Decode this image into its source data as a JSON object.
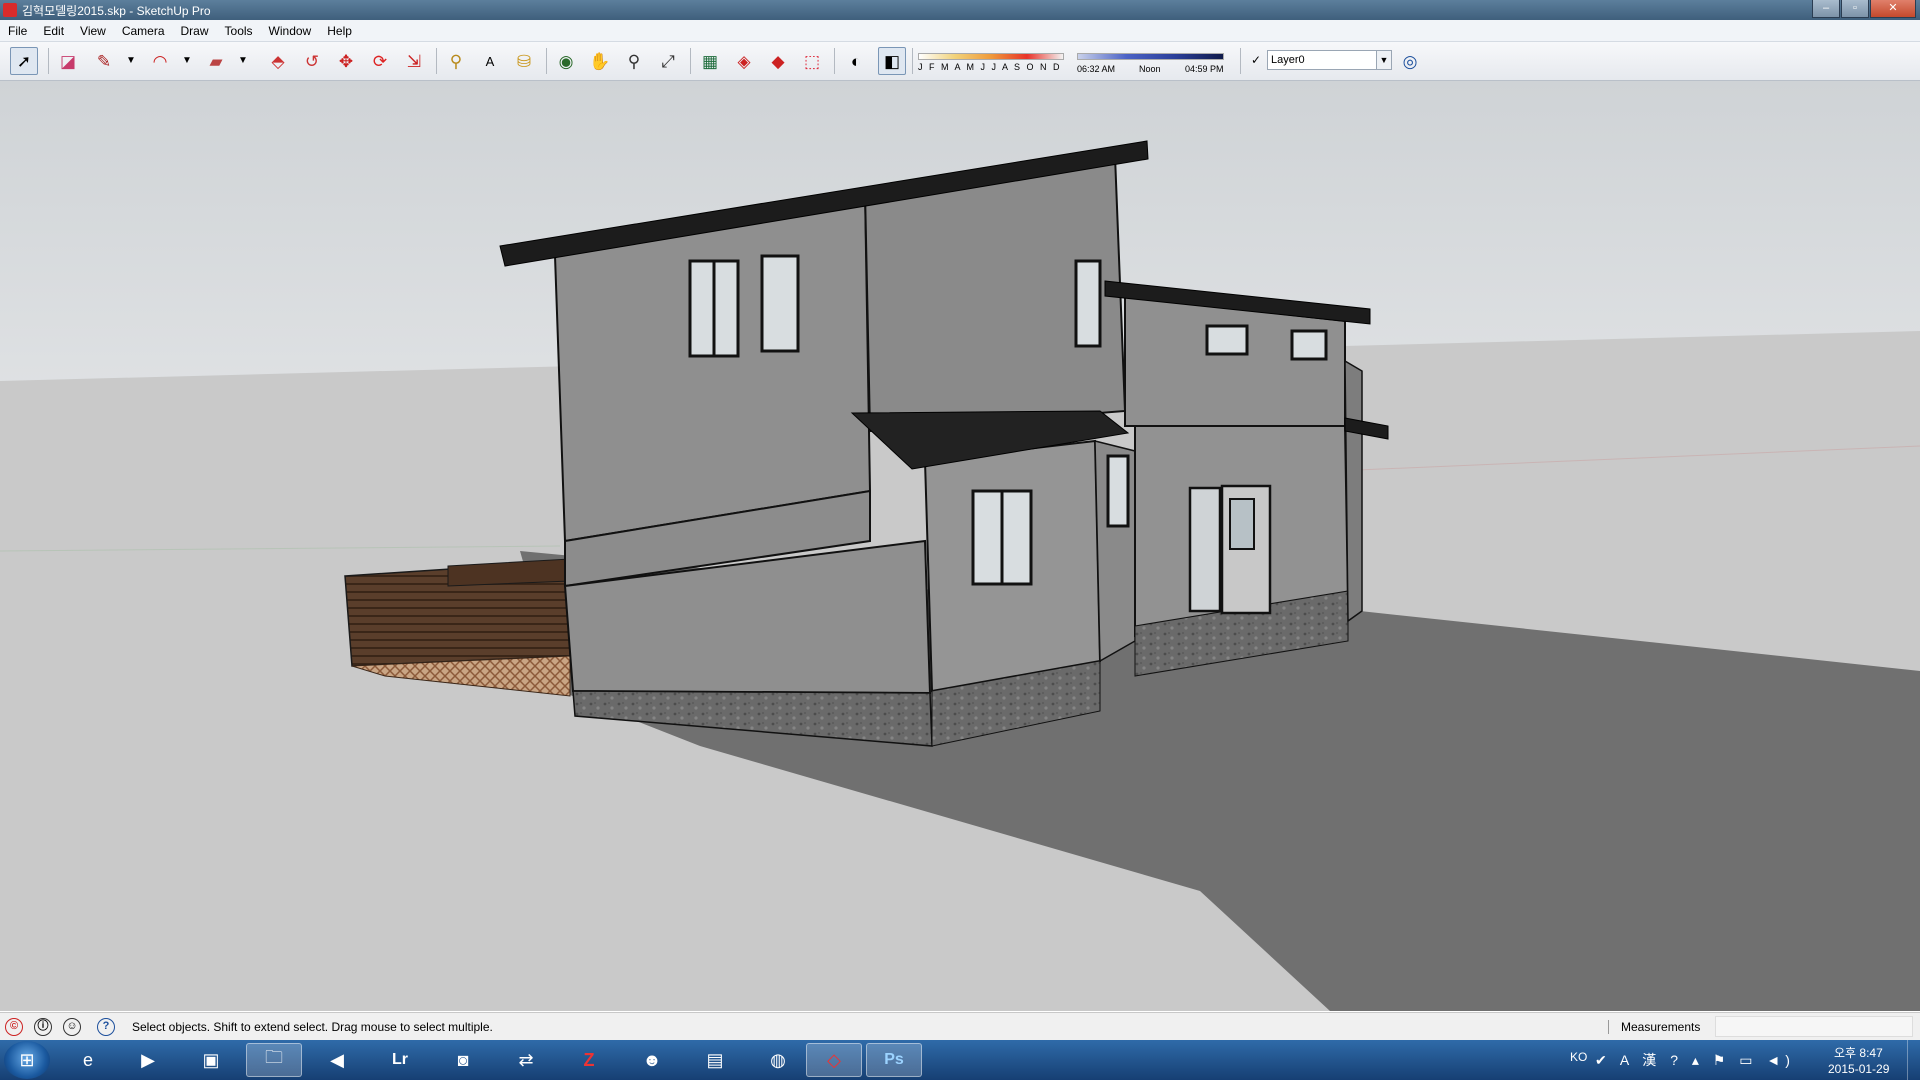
{
  "window": {
    "title": "김혁모델링2015.skp - SketchUp Pro",
    "controls": [
      "–",
      "▫",
      "✕"
    ]
  },
  "menu": [
    "File",
    "Edit",
    "View",
    "Camera",
    "Draw",
    "Tools",
    "Window",
    "Help"
  ],
  "toolbar": {
    "tools": [
      {
        "name": "select-tool-icon",
        "glyph": "➚"
      },
      {
        "name": "eraser-tool-icon",
        "glyph": "◪"
      },
      {
        "name": "pencil-line-tool-icon",
        "glyph": "✎"
      },
      {
        "name": "line-dropdown-icon",
        "glyph": "▼"
      },
      {
        "name": "arc-tool-icon",
        "glyph": "◠"
      },
      {
        "name": "arc-dropdown-icon",
        "glyph": "▼"
      },
      {
        "name": "rectangle-tool-icon",
        "glyph": "▰"
      },
      {
        "name": "shape-dropdown-icon",
        "glyph": "▼"
      },
      {
        "name": "push-pull-tool-icon",
        "glyph": "⬘"
      },
      {
        "name": "offset-tool-icon",
        "glyph": "↺"
      },
      {
        "name": "move-tool-icon",
        "glyph": "✥"
      },
      {
        "name": "rotate-tool-icon",
        "glyph": "⟳"
      },
      {
        "name": "scale-tool-icon",
        "glyph": "⇲"
      },
      {
        "name": "tape-measure-tool-icon",
        "glyph": "⚲"
      },
      {
        "name": "text-tool-icon",
        "glyph": "A"
      },
      {
        "name": "paint-bucket-tool-icon",
        "glyph": "⛁"
      },
      {
        "name": "orbit-tool-icon",
        "glyph": "◉"
      },
      {
        "name": "pan-tool-icon",
        "glyph": "✋"
      },
      {
        "name": "zoom-tool-icon",
        "glyph": "⚲"
      },
      {
        "name": "zoom-extents-tool-icon",
        "glyph": "⤢"
      },
      {
        "name": "warehouse-icon",
        "glyph": "▦"
      },
      {
        "name": "get-models-icon",
        "glyph": "◈"
      },
      {
        "name": "share-model-icon",
        "glyph": "◆"
      },
      {
        "name": "extension-warehouse-icon",
        "glyph": "⬚"
      },
      {
        "name": "shadows-toggle-icon",
        "glyph": "◐"
      },
      {
        "name": "fog-toggle-icon",
        "glyph": "◧"
      }
    ],
    "months": "J F M A M J J A S O N D",
    "time_start": "06:32 AM",
    "time_mid": "Noon",
    "time_end": "04:59 PM",
    "layer_check": "✓",
    "layer": "Layer0",
    "layer_manager_glyph": "◎"
  },
  "status": {
    "hint": "Select objects. Shift to extend select. Drag mouse to select multiple.",
    "icons": [
      "©",
      "ⓘ",
      "☺",
      "?"
    ],
    "measurements_label": "Measurements",
    "measurements_value": ""
  },
  "taskbar": {
    "start_glyph": "⊞",
    "apps": [
      {
        "name": "internet-explorer-icon",
        "glyph": "e",
        "active": false
      },
      {
        "name": "media-player-icon",
        "glyph": "▶",
        "active": false
      },
      {
        "name": "photo-app-icon",
        "glyph": "▣",
        "active": false
      },
      {
        "name": "file-explorer-icon",
        "glyph": "🗀",
        "active": true
      },
      {
        "name": "visual-studio-icon",
        "glyph": "◀",
        "active": false
      },
      {
        "name": "lightroom-icon",
        "glyph": "Lr",
        "active": false
      },
      {
        "name": "camera-app-icon",
        "glyph": "◙",
        "active": false
      },
      {
        "name": "network-app-icon",
        "glyph": "⇄",
        "active": false
      },
      {
        "name": "filezilla-icon",
        "glyph": "Z",
        "active": false
      },
      {
        "name": "qq-messenger-icon",
        "glyph": "☻",
        "active": false
      },
      {
        "name": "archive-app-icon",
        "glyph": "▤",
        "active": false
      },
      {
        "name": "chrome-icon",
        "glyph": "◍",
        "active": false
      },
      {
        "name": "sketchup-icon",
        "glyph": "◇",
        "active": true
      },
      {
        "name": "photoshop-icon",
        "glyph": "Ps",
        "active": true
      }
    ],
    "lang": "KO",
    "tray_glyphs": "✔ A 漢 ? ▴ ⚑ ▭ ◄)",
    "time": "오후 8:47",
    "date": "2015-01-29"
  },
  "colors": {
    "wall": "#8f8f8f",
    "roof": "#1c1c1c",
    "stone": "#6a6a6a",
    "deck": "#5a3e2b",
    "ground_shadow": "#707070",
    "ground_light": "#c9c9c9"
  }
}
